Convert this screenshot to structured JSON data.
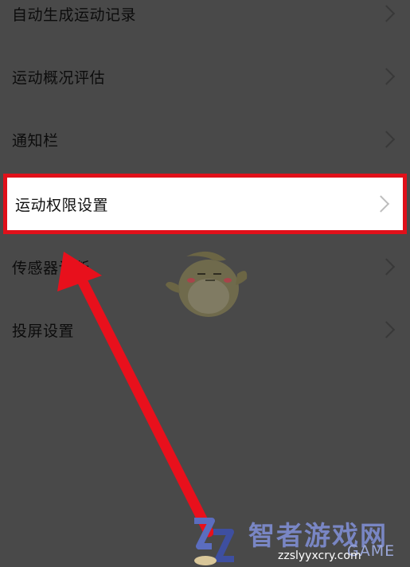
{
  "settings": {
    "items": [
      {
        "label": "自动生成运动记录"
      },
      {
        "label": "运动概况评估"
      },
      {
        "label": "通知栏"
      },
      {
        "label": "运动权限设置"
      },
      {
        "label": "传感器诊断"
      },
      {
        "label": "投屏设置"
      }
    ],
    "highlighted_index": 3
  },
  "watermark": {
    "title": "智者游戏网",
    "url": "zzslyyxcry.com",
    "game": "GAME"
  },
  "colors": {
    "overlay_bg": "#494949",
    "highlight_border": "#e0101a",
    "arrow": "#e8101c",
    "watermark_text": "#7986c4"
  },
  "icons": {
    "chevron": "chevron-right-icon",
    "arrow": "red-arrow-annotation",
    "mascot": "mascot-chick-icon",
    "logo": "zz-logo-icon"
  }
}
